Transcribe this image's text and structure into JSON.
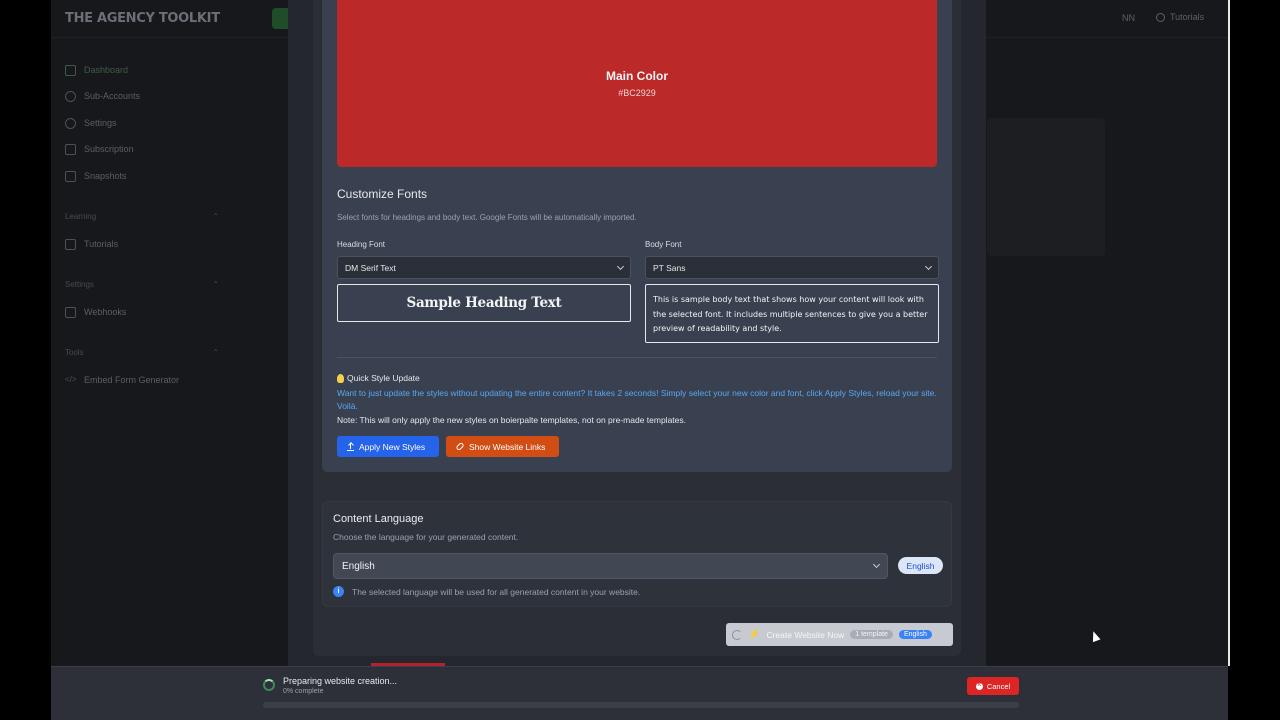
{
  "app": {
    "brand": "THE AGENCY TOOLKIT",
    "top_user": "NN",
    "top_tutorials": "Tutorials"
  },
  "sidebar": {
    "items": [
      {
        "label": "Dashboard"
      },
      {
        "label": "Sub-Accounts"
      },
      {
        "label": "Settings"
      },
      {
        "label": "Subscription"
      },
      {
        "label": "Snapshots"
      }
    ],
    "learning_heading": "Learning",
    "learning_items": [
      {
        "label": "Tutorials"
      }
    ],
    "settings_heading": "Settings",
    "settings_items": [
      {
        "label": "Webhooks"
      }
    ],
    "tools_heading": "Tools",
    "tools_items": [
      {
        "label": "Embed Form Generator"
      }
    ]
  },
  "main_color": {
    "label": "Main Color",
    "hex": "#BC2929"
  },
  "fonts": {
    "title": "Customize Fonts",
    "description": "Select fonts for headings and body text. Google Fonts will be automatically imported.",
    "heading_label": "Heading Font",
    "heading_value": "DM Serif Text",
    "body_label": "Body Font",
    "body_value": "PT Sans",
    "heading_preview": "Sample Heading Text",
    "body_preview": "This is sample body text that shows how your content will look with the selected font. It includes multiple sentences to give you a better preview of readability and style."
  },
  "quick_style": {
    "title": "Quick Style Update",
    "blue_text": "Want to just update the styles without updating the entire content? It takes 2 seconds! Simply select your new color and font, click Apply Styles, reload your site. Voilà.",
    "note": "Note: This will only apply the new styles on boierpalte templates, not on pre-made templates.",
    "apply_label": "Apply New Styles",
    "links_label": "Show Website Links"
  },
  "language": {
    "title": "Content Language",
    "description": "Choose the language for your generated content.",
    "selected": "English",
    "badge": "English",
    "info": "The selected language will be used for all generated content in your website."
  },
  "create": {
    "label": "Create Website Now",
    "template_badge": "1 template",
    "lang_badge": "English"
  },
  "progress": {
    "status": "Preparing website creation...",
    "percent_text": "0% complete",
    "percent": 0,
    "cancel_label": "Cancel"
  }
}
